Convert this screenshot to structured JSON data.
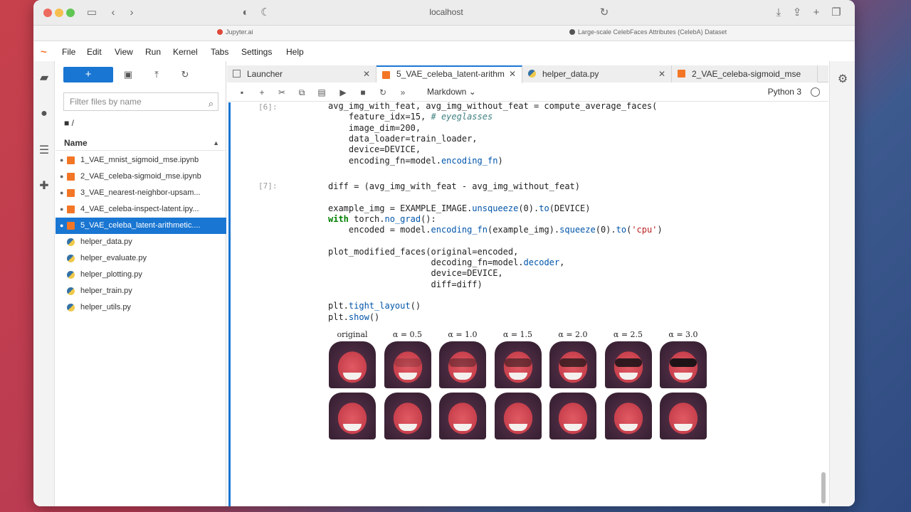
{
  "browser": {
    "url": "localhost",
    "tabs": [
      {
        "label": "Jupyter.ai",
        "color": "#e0483a"
      },
      {
        "label": "Large-scale CelebFaces Attributes (CelebA) Dataset",
        "color": "#555555"
      }
    ]
  },
  "menu": {
    "items": [
      "File",
      "Edit",
      "View",
      "Run",
      "Kernel",
      "Tabs",
      "Settings",
      "Help"
    ]
  },
  "filebrowser": {
    "new_label": "+",
    "filter_placeholder": "Filter files by name",
    "path": "/",
    "header": "Name",
    "files": [
      {
        "name": "1_VAE_mnist_sigmoid_mse.ipynb",
        "type": "notebook",
        "running": true,
        "selected": false
      },
      {
        "name": "2_VAE_celeba-sigmoid_mse.ipynb",
        "type": "notebook",
        "running": true,
        "selected": false
      },
      {
        "name": "3_VAE_nearest-neighbor-upsam...",
        "type": "notebook",
        "running": true,
        "selected": false
      },
      {
        "name": "4_VAE_celeba-inspect-latent.ipy...",
        "type": "notebook",
        "running": true,
        "selected": false
      },
      {
        "name": "5_VAE_celeba_latent-arithmetic....",
        "type": "notebook",
        "running": true,
        "selected": true
      },
      {
        "name": "helper_data.py",
        "type": "python",
        "running": false,
        "selected": false
      },
      {
        "name": "helper_evaluate.py",
        "type": "python",
        "running": false,
        "selected": false
      },
      {
        "name": "helper_plotting.py",
        "type": "python",
        "running": false,
        "selected": false
      },
      {
        "name": "helper_train.py",
        "type": "python",
        "running": false,
        "selected": false
      },
      {
        "name": "helper_utils.py",
        "type": "python",
        "running": false,
        "selected": false
      }
    ]
  },
  "tabs": [
    {
      "label": "Launcher",
      "active": false
    },
    {
      "label": "5_VAE_celeba_latent-arithm",
      "active": true
    },
    {
      "label": "helper_data.py",
      "active": false
    },
    {
      "label": "2_VAE_celeba-sigmoid_mse",
      "active": false
    }
  ],
  "notebook": {
    "cell_type": "Markdown",
    "kernel": "Python 3",
    "prompt1": "[6]:",
    "prompt2": "[7]:",
    "cell1": [
      "avg_img_with_feat, avg_img_without_feat = compute_average_faces(",
      "    feature_idx=15, # eyeglasses",
      "    image_dim=200,",
      "    data_loader=train_loader,",
      "    device=DEVICE,",
      "    encoding_fn=model.encoding_fn)"
    ],
    "cell2": [
      "diff = (avg_img_with_feat - avg_img_without_feat)",
      "",
      "example_img = EXAMPLE_IMAGE.unsqueeze(0).to(DEVICE)",
      "with torch.no_grad():",
      "    encoded = model.encoding_fn(example_img).squeeze(0).to('cpu')",
      "",
      "plot_modified_faces(original=encoded,",
      "                    decoding_fn=model.decoder,",
      "                    device=DEVICE,",
      "                    diff=diff)",
      "",
      "plt.tight_layout()",
      "plt.show()"
    ],
    "output_labels": [
      "original",
      "α = 0.5",
      "α = 1.0",
      "α = 1.5",
      "α = 2.0",
      "α = 2.5",
      "α = 3.0"
    ],
    "glasses_level_row1": [
      0,
      0.2,
      0.4,
      0.55,
      0.75,
      0.9,
      1.0
    ]
  }
}
